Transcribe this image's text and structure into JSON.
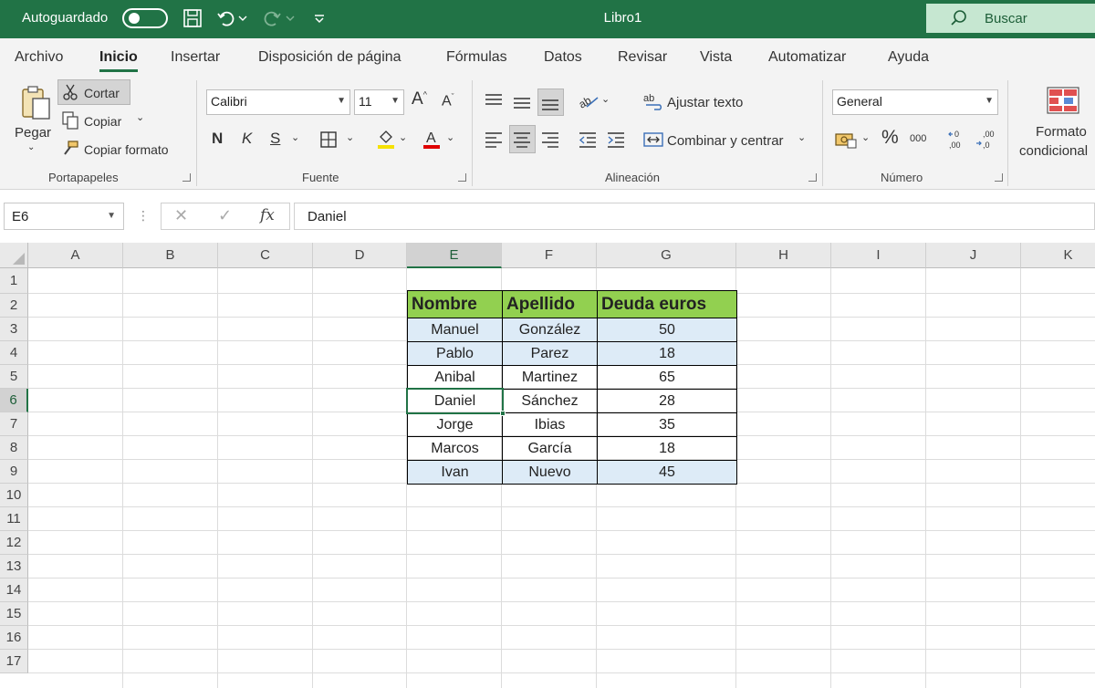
{
  "titlebar": {
    "autosave_label": "Autoguardado",
    "title": "Libro1",
    "search_label": "Buscar"
  },
  "tabs": [
    "Archivo",
    "Inicio",
    "Insertar",
    "Disposición de página",
    "Fórmulas",
    "Datos",
    "Revisar",
    "Vista",
    "Automatizar",
    "Ayuda"
  ],
  "active_tab": "Inicio",
  "ribbon": {
    "clipboard": {
      "paste": "Pegar",
      "cut": "Cortar",
      "copy": "Copiar",
      "format_painter": "Copiar formato",
      "group": "Portapapeles"
    },
    "font": {
      "name": "Calibri",
      "size": "11",
      "bold": "N",
      "italic": "K",
      "underline": "S",
      "group": "Fuente"
    },
    "alignment": {
      "wrap": "Ajustar texto",
      "merge": "Combinar y centrar",
      "group": "Alineación"
    },
    "number": {
      "format": "General",
      "group": "Número"
    },
    "styles": {
      "cond_format_line1": "Formato",
      "cond_format_line2": "condicional"
    }
  },
  "formula_bar": {
    "name_box": "E6",
    "value": "Daniel"
  },
  "grid": {
    "columns": [
      "A",
      "B",
      "C",
      "D",
      "E",
      "F",
      "G",
      "H",
      "I",
      "J",
      "K"
    ],
    "rows": [
      "1",
      "2",
      "3",
      "4",
      "5",
      "6",
      "7",
      "8",
      "9",
      "10",
      "11",
      "12",
      "13",
      "14",
      "15",
      "16",
      "17"
    ],
    "selected_cell": "E6"
  },
  "table": {
    "headers": [
      "Nombre",
      "Apellido",
      "Deuda euros"
    ],
    "rows": [
      [
        "Manuel",
        "González",
        "50"
      ],
      [
        "Pablo",
        "Parez",
        "18"
      ],
      [
        "Anibal",
        "Martinez",
        "65"
      ],
      [
        "Daniel",
        "Sánchez",
        "28"
      ],
      [
        "Jorge",
        "Ibias",
        "35"
      ],
      [
        "Marcos",
        "García",
        "18"
      ],
      [
        "Ivan",
        "Nuevo",
        "45"
      ]
    ]
  },
  "colors": {
    "accent": "#217346",
    "header_fill": "#92d050",
    "band_fill": "#ddebf7"
  }
}
